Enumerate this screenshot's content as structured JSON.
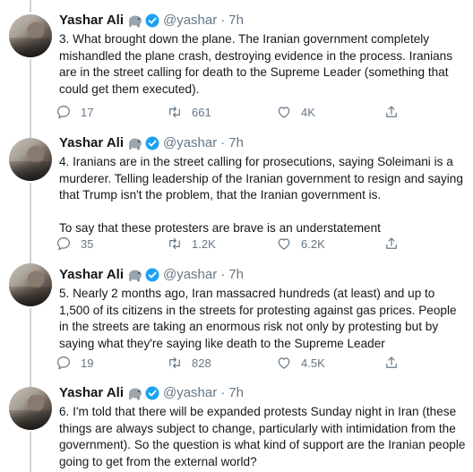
{
  "tweets": [
    {
      "author": "Yashar Ali",
      "emoji": "elephant-emoji",
      "handle": "@yashar",
      "separator": "·",
      "time": "7h",
      "paragraphs": [
        "3. What brought down the plane. The Iranian government completely mishandled the plane crash, destroying evidence in the process. Iranians are in the street calling for death to the Supreme Leader (something that could get them executed)."
      ],
      "replies": "17",
      "retweets": "661",
      "likes": "4K"
    },
    {
      "author": "Yashar Ali",
      "emoji": "elephant-emoji",
      "handle": "@yashar",
      "separator": "·",
      "time": "7h",
      "paragraphs": [
        "4. Iranians are in the street calling for prosecutions, saying Soleimani is a murderer. Telling leadership of the Iranian government to resign and saying that Trump isn't the problem, that the Iranian government is.",
        "To say that these protesters are brave is an understatement"
      ],
      "replies": "35",
      "retweets": "1.2K",
      "likes": "6.2K"
    },
    {
      "author": "Yashar Ali",
      "emoji": "elephant-emoji",
      "handle": "@yashar",
      "separator": "·",
      "time": "7h",
      "paragraphs": [
        "5. Nearly 2 months ago, Iran massacred hundreds (at least) and up to 1,500 of its citizens in the streets for protesting against gas prices. People in the streets are taking an enormous risk not only by protesting but by saying what they're saying like death to the Supreme Leader"
      ],
      "replies": "19",
      "retweets": "828",
      "likes": "4.5K"
    },
    {
      "author": "Yashar Ali",
      "emoji": "elephant-emoji",
      "handle": "@yashar",
      "separator": "·",
      "time": "7h",
      "paragraphs": [
        "6. I'm told that there will be expanded protests Sunday night in Iran (these things are always subject to change, particularly with intimidation from the government). So the question is what kind of support are the Iranian people going to get from the external world?"
      ]
    }
  ],
  "colors": {
    "text": "#14171a",
    "secondary": "#657786",
    "verified": "#1da1f2",
    "thread_line": "#ccd6dd"
  },
  "icons": {
    "reply": "reply-icon",
    "retweet": "retweet-icon",
    "like": "heart-icon",
    "share": "share-icon",
    "verified": "verified-badge-icon"
  }
}
